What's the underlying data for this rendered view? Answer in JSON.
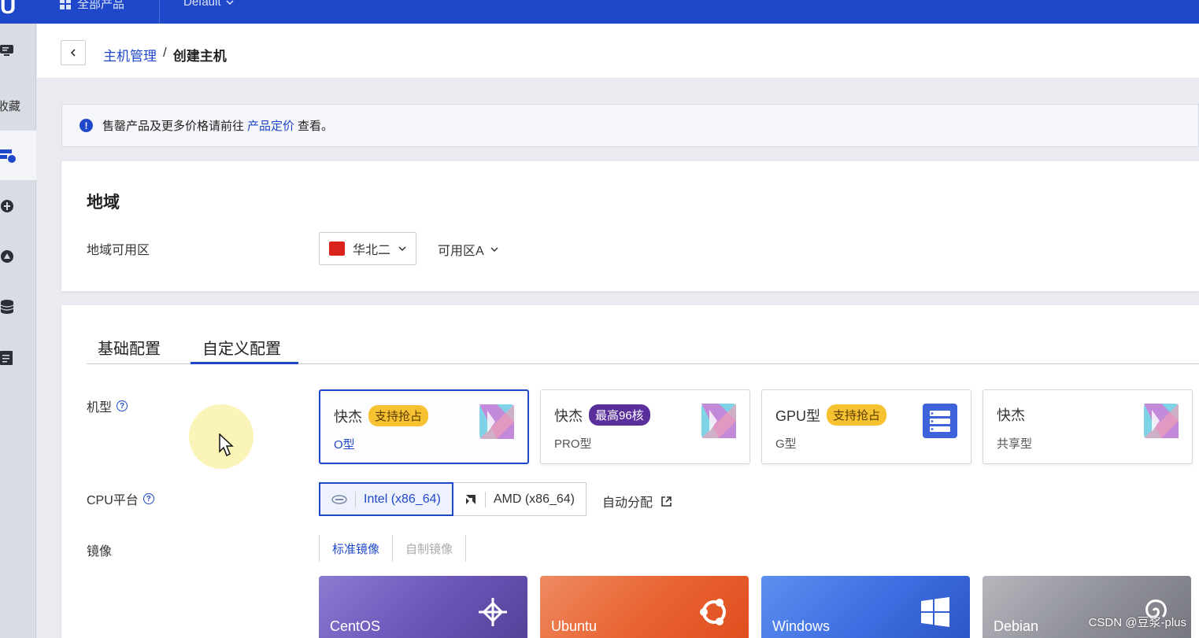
{
  "topbar": {
    "logo": "U",
    "products_label": "全部产品",
    "project_label": "Default"
  },
  "sidebar": {
    "favorites_label": "收藏"
  },
  "breadcrumb": {
    "parent": "主机管理",
    "separator": "/",
    "current": "创建主机"
  },
  "notice": {
    "prefix": "售罄产品及更多价格请前往",
    "link": "产品定价",
    "suffix": "查看。"
  },
  "region": {
    "title": "地域",
    "label": "地域可用区",
    "region_value": "华北二",
    "zone_value": "可用区A"
  },
  "tabs": [
    {
      "label": "基础配置"
    },
    {
      "label": "自定义配置"
    }
  ],
  "machine": {
    "label": "机型",
    "options": [
      {
        "name": "快杰",
        "badge": "支持抢占",
        "sub": "O型"
      },
      {
        "name": "快杰",
        "badge": "最高96核",
        "sub": "PRO型"
      },
      {
        "name": "GPU型",
        "badge": "支持抢占",
        "sub": "G型"
      },
      {
        "name": "快杰",
        "badge": "",
        "sub": "共享型"
      }
    ]
  },
  "cpu": {
    "label": "CPU平台",
    "options": [
      {
        "label": "Intel (x86_64)"
      },
      {
        "label": "AMD (x86_64)"
      }
    ],
    "auto_label": "自动分配"
  },
  "image": {
    "label": "镜像",
    "tabs": [
      {
        "label": "标准镜像"
      },
      {
        "label": "自制镜像"
      }
    ],
    "os": [
      {
        "name": "CentOS"
      },
      {
        "name": "Ubuntu"
      },
      {
        "name": "Windows"
      },
      {
        "name": "Debian"
      }
    ]
  },
  "watermark": "CSDN @豆浆-plus",
  "colors": {
    "primary": "#1f47c9",
    "badge_yellow": "#f7c232",
    "badge_purple": "#5a2f9c"
  }
}
